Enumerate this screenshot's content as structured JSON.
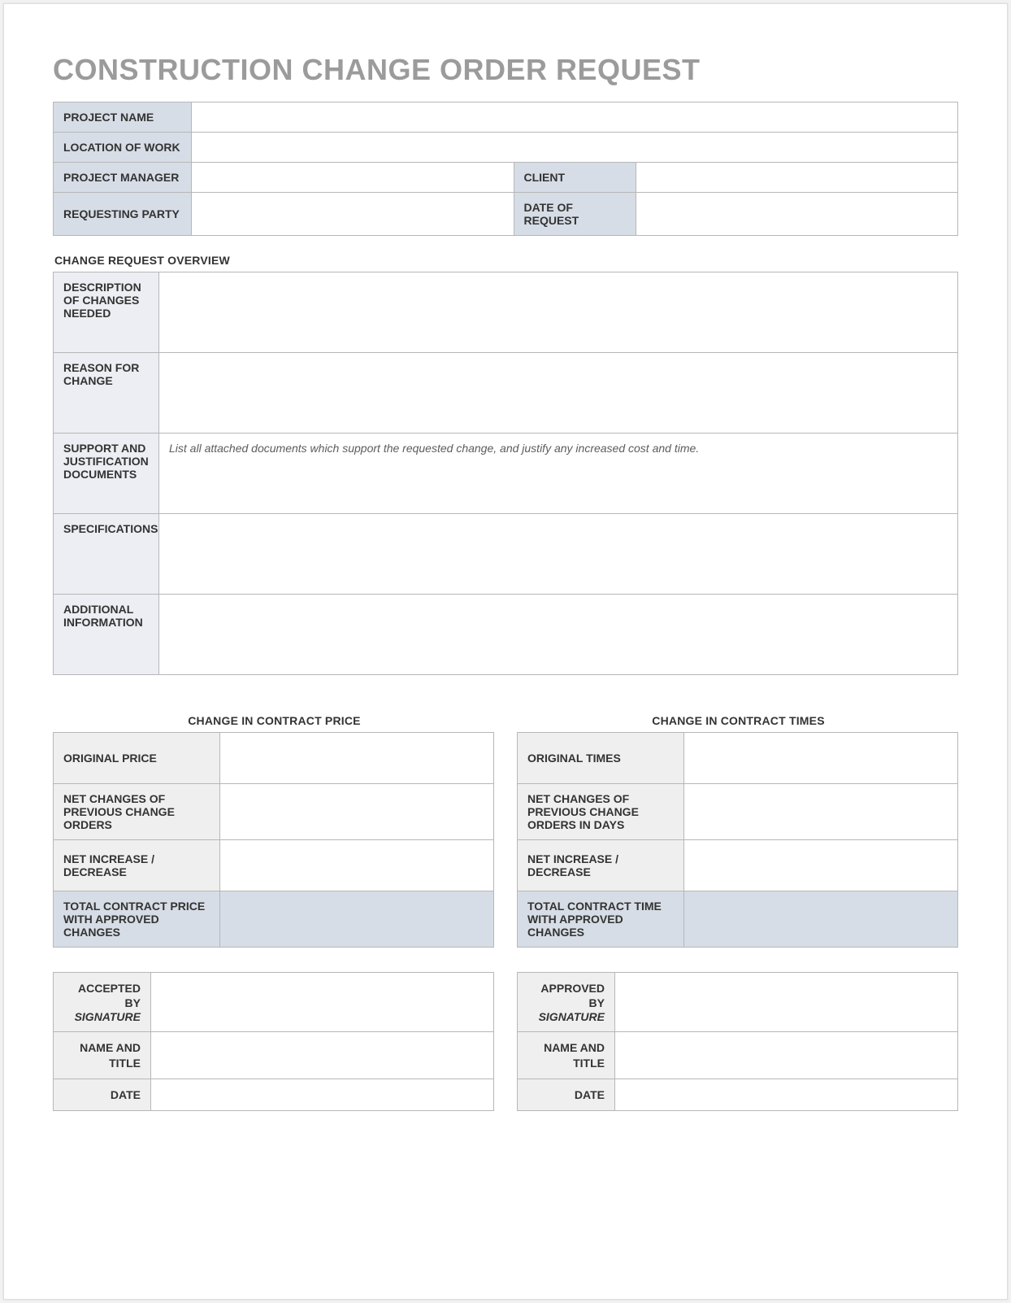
{
  "title": "CONSTRUCTION CHANGE ORDER REQUEST",
  "header": {
    "project_name_label": "PROJECT NAME",
    "project_name_value": "",
    "location_label": "LOCATION OF WORK",
    "location_value": "",
    "project_manager_label": "PROJECT MANAGER",
    "project_manager_value": "",
    "client_label": "CLIENT",
    "client_value": "",
    "requesting_party_label": "REQUESTING PARTY",
    "requesting_party_value": "",
    "date_of_request_label": "DATE OF REQUEST",
    "date_of_request_value": ""
  },
  "overview": {
    "section_title": "CHANGE REQUEST OVERVIEW",
    "description_label": "DESCRIPTION OF CHANGES NEEDED",
    "description_value": "",
    "reason_label": "REASON FOR CHANGE",
    "reason_value": "",
    "support_label": "SUPPORT AND JUSTIFICATION DOCUMENTS",
    "support_note": "List all attached documents which support the requested change, and justify any increased cost and time.",
    "specifications_label": "SPECIFICATIONS",
    "specifications_value": "",
    "additional_label": "ADDITIONAL INFORMATION",
    "additional_value": ""
  },
  "price": {
    "section_title": "CHANGE IN CONTRACT PRICE",
    "original_label": "ORIGINAL PRICE",
    "original_value": "",
    "net_previous_label": "NET CHANGES OF PREVIOUS CHANGE ORDERS",
    "net_previous_value": "",
    "net_inc_dec_label": "NET INCREASE / DECREASE",
    "net_inc_dec_value": "",
    "total_label": "TOTAL CONTRACT PRICE WITH APPROVED CHANGES",
    "total_value": ""
  },
  "times": {
    "section_title": "CHANGE IN CONTRACT TIMES",
    "original_label": "ORIGINAL TIMES",
    "original_value": "",
    "net_previous_label": "NET CHANGES OF PREVIOUS CHANGE ORDERS IN DAYS",
    "net_previous_value": "",
    "net_inc_dec_label": "NET INCREASE / DECREASE",
    "net_inc_dec_value": "",
    "total_label": "TOTAL CONTRACT TIME WITH APPROVED CHANGES",
    "total_value": ""
  },
  "accepted": {
    "by_label": "ACCEPTED BY",
    "sig_label": "SIGNATURE",
    "sig_value": "",
    "name_label": "NAME AND TITLE",
    "name_value": "",
    "date_label": "DATE",
    "date_value": ""
  },
  "approved": {
    "by_label": "APPROVED BY",
    "sig_label": "SIGNATURE",
    "sig_value": "",
    "name_label": "NAME AND TITLE",
    "name_value": "",
    "date_label": "DATE",
    "date_value": ""
  }
}
